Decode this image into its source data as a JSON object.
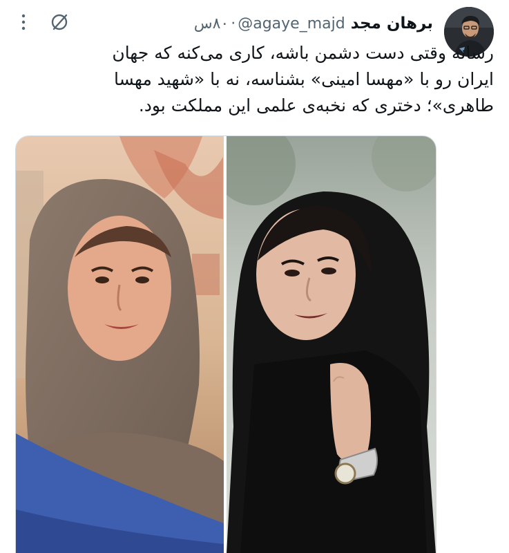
{
  "tweet": {
    "display_name": "برهان مجد",
    "handle": "@agaye_majd",
    "separator": "·",
    "time": "۸۰س",
    "text_lines": [
      "رسانه وقتی دست دشمن باشه، کاری می‌کنه که جهان",
      "ایران رو با «مهسا امینی» بشناسه، نه با «شهید مهسا",
      "طاهری»؛ دختری که نخبه‌ی علمی این مملکت بود."
    ]
  },
  "icons": {
    "grok": "grok-slash-circle-icon",
    "more": "more-vertical-icon"
  },
  "colors": {
    "text": "#0f1419",
    "secondary": "#536471",
    "border": "#cfd9de"
  }
}
